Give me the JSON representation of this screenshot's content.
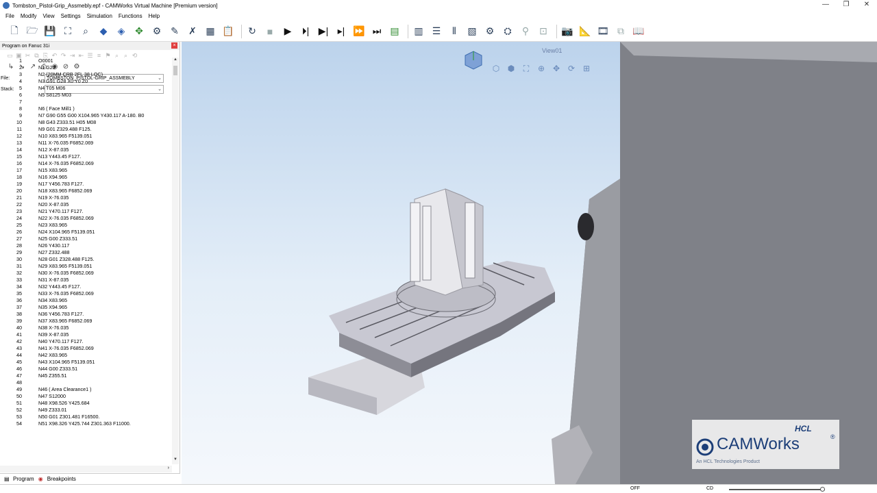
{
  "window": {
    "title": "Tombston_Pistol-Grip_Assmebly.epf - CAMWorks Virtual Machine [Premium version]",
    "minimize": "—",
    "maximize": "❐",
    "close": "✕"
  },
  "menu": [
    "File",
    "Modify",
    "View",
    "Settings",
    "Simulation",
    "Functions",
    "Help"
  ],
  "panel": {
    "title": "Program on Fanuc 31i",
    "close": "×",
    "file_label": "File:",
    "file_value": "TOMBSTON_PISTOL-GRIP_ASSMEBLY",
    "stack_label": "Stack:",
    "stack_value": ""
  },
  "code_lines": [
    [
      "1",
      "O0001"
    ],
    [
      "2",
      "N1 G21"
    ],
    [
      "3",
      "N2 (20MM CRB 2FL 38 LOC)"
    ],
    [
      "4",
      "N3 G91 G28 X0 Y0 Z0"
    ],
    [
      "5",
      "N4 T05 M06"
    ],
    [
      "6",
      "N5 S8125 M03"
    ],
    [
      "7",
      ""
    ],
    [
      "8",
      "N6 ( Face Mill1 )"
    ],
    [
      "9",
      "N7 G90 G55 G00 X104.965 Y430.117 A-180. B0"
    ],
    [
      "10",
      "N8 G43 Z333.51 H05 M08"
    ],
    [
      "11",
      "N9 G01 Z329.488 F125."
    ],
    [
      "12",
      "N10 X83.965 F5139.051"
    ],
    [
      "13",
      "N11 X-76.035 F6852.069"
    ],
    [
      "14",
      "N12 X-87.035"
    ],
    [
      "15",
      "N13 Y443.45 F127."
    ],
    [
      "16",
      "N14 X-76.035 F6852.069"
    ],
    [
      "17",
      "N15 X83.965"
    ],
    [
      "18",
      "N16 X94.965"
    ],
    [
      "19",
      "N17 Y456.783 F127."
    ],
    [
      "20",
      "N18 X83.965 F6852.069"
    ],
    [
      "21",
      "N19 X-76.035"
    ],
    [
      "22",
      "N20 X-87.035"
    ],
    [
      "23",
      "N21 Y470.117 F127."
    ],
    [
      "24",
      "N22 X-76.035 F6852.069"
    ],
    [
      "25",
      "N23 X83.965"
    ],
    [
      "26",
      "N24 X104.965 F5139.051"
    ],
    [
      "27",
      "N25 G00 Z333.51"
    ],
    [
      "28",
      "N26 Y430.117"
    ],
    [
      "29",
      "N27 Z332.488"
    ],
    [
      "30",
      "N28 G01 Z328.488 F125."
    ],
    [
      "31",
      "N29 X83.965 F5139.051"
    ],
    [
      "32",
      "N30 X-76.035 F6852.069"
    ],
    [
      "33",
      "N31 X-87.035"
    ],
    [
      "34",
      "N32 Y443.45 F127."
    ],
    [
      "35",
      "N33 X-76.035 F6852.069"
    ],
    [
      "36",
      "N34 X83.965"
    ],
    [
      "37",
      "N35 X94.965"
    ],
    [
      "38",
      "N36 Y456.783 F127."
    ],
    [
      "39",
      "N37 X83.965 F6852.069"
    ],
    [
      "40",
      "N38 X-76.035"
    ],
    [
      "41",
      "N39 X-87.035"
    ],
    [
      "42",
      "N40 Y470.117 F127."
    ],
    [
      "43",
      "N41 X-76.035 F6852.069"
    ],
    [
      "44",
      "N42 X83.965"
    ],
    [
      "45",
      "N43 X104.965 F5139.051"
    ],
    [
      "46",
      "N44 G00 Z333.51"
    ],
    [
      "47",
      "N45 Z355.51"
    ],
    [
      "48",
      ""
    ],
    [
      "49",
      "N46 ( Area Clearance1 )"
    ],
    [
      "50",
      "N47 S12000"
    ],
    [
      "51",
      "N48 X98.526 Y425.684"
    ],
    [
      "52",
      "N49 Z333.01"
    ],
    [
      "53",
      "N50 G01 Z301.481 F16500."
    ],
    [
      "54",
      "N51 X98.326 Y425.744 Z301.363 F11000."
    ]
  ],
  "tabs": {
    "program": "Program",
    "breakpoints": "Breakpoints"
  },
  "viewport": {
    "view_name": "View01"
  },
  "logo": {
    "hcl": "HCL",
    "camworks": "CAMWorks",
    "reg": "®",
    "subtitle": "An HCL Technologies Product"
  },
  "status": {
    "off": "OFF",
    "cd": "CD",
    "slider_value": 1.0
  },
  "colors": {
    "accent": "#1c3e78",
    "sky_top": "#bcd3ec",
    "play_green": "#2f8a2f"
  }
}
